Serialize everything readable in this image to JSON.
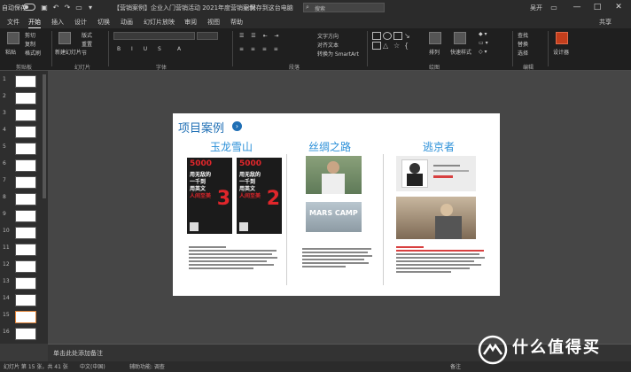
{
  "titlebar": {
    "autosave": "自动保存",
    "doc_title": "【营销案例】企业入门营销活动 2021年度营销案例合集  (…)",
    "saved_state": "- 已保存到这台电脑",
    "search_placeholder": "搜索",
    "user": "吴开",
    "minimize": "—",
    "maximize": "□",
    "close": "✕"
  },
  "menubar": {
    "items": [
      "文件",
      "开始",
      "插入",
      "设计",
      "切换",
      "动画",
      "幻灯片放映",
      "审阅",
      "视图",
      "帮助"
    ],
    "active_index": 1,
    "share": "共享"
  },
  "ribbon": {
    "groups": [
      "剪贴板",
      "幻灯片",
      "字体",
      "段落",
      "绘图",
      "编辑"
    ],
    "paste": "粘贴",
    "new_slide": "新建幻灯片",
    "clipboard_items": [
      "剪切",
      "复制",
      "格式刷"
    ],
    "slide_items": [
      "版式",
      "重置",
      "节"
    ],
    "font_name": "",
    "font_size": "",
    "text_direction": "文字方向",
    "align_text": "对齐文本",
    "convert_smartart": "转换为 SmartArt",
    "arrange": "排列",
    "quick_styles": "快速样式",
    "edit_items": [
      "查找",
      "替换",
      "选择"
    ],
    "extra": "设计器"
  },
  "slides": {
    "numbers": [
      "1",
      "2",
      "3",
      "4",
      "5",
      "6",
      "7",
      "8",
      "9",
      "10",
      "11",
      "12",
      "13",
      "14",
      "15",
      "16"
    ],
    "selected": 15
  },
  "slide": {
    "title": "项目案例",
    "columns": [
      {
        "title": "玉龙雪山"
      },
      {
        "title": "丝绸之路"
      },
      {
        "title": "逃京者"
      }
    ],
    "poster_left": {
      "big": "5000",
      "lines": [
        "用无敌的",
        "一千到",
        "用英文",
        "人间至美"
      ],
      "number": "3"
    },
    "poster_right": {
      "big": "5000",
      "lines": [
        "用无敌的",
        "一千到",
        "用英文",
        "人间至美"
      ],
      "number": "2"
    },
    "camp_sign": "MARS CAMP"
  },
  "notes": {
    "placeholder": "单击此处添加备注"
  },
  "status": {
    "slide_info": "幻灯片 第 15 张，共 41 张",
    "language": "中文(中国)",
    "accessibility": "辅助功能: 调查",
    "notes_btn": "备注"
  },
  "watermark": {
    "text": "什么值得买",
    "icon": "smzdm-logo-icon"
  },
  "colors": {
    "accent": "#c43e1c",
    "title_blue": "#1f6fb5",
    "column_blue": "#2a8fd8",
    "poster_red": "#e0262b"
  }
}
